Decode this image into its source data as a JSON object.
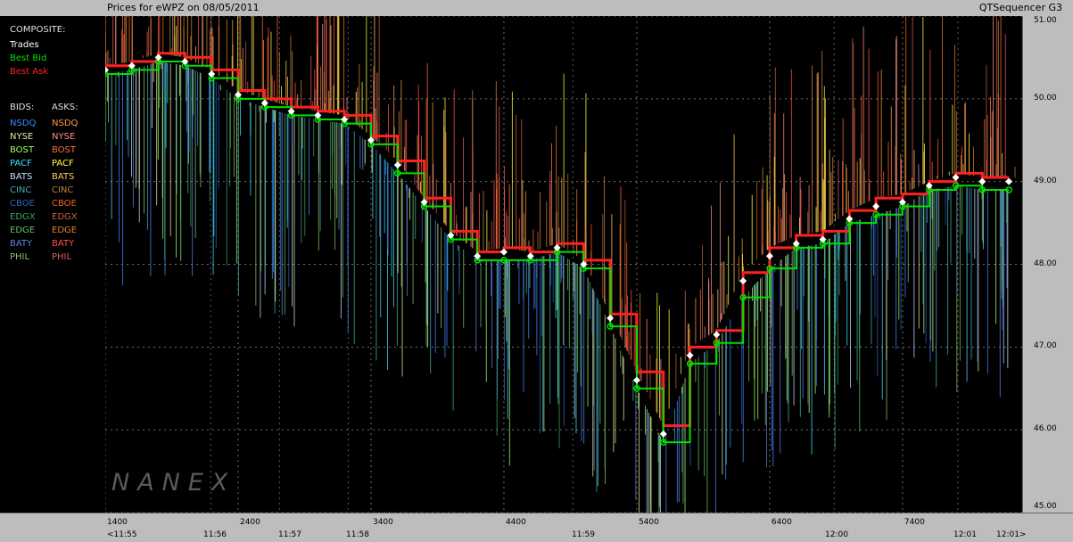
{
  "header": {
    "left_title": "Prices for  eWPZ  on  08/05/2011",
    "right_title": "QTSequencer G3"
  },
  "legend": {
    "composite_label": "COMPOSITE:",
    "trades_label": "Trades",
    "best_bid_label": "Best Bid",
    "best_ask_label": "Best Ask",
    "bids_header": "BIDS:",
    "asks_header": "ASKS:",
    "exchanges": [
      {
        "bid": "NSDQ",
        "ask": "NSDQ",
        "bid_color": "#3c8cff",
        "ask_color": "#ff9a40"
      },
      {
        "bid": "NYSE",
        "ask": "NYSE",
        "bid_color": "#e8e8a0",
        "ask_color": "#ff8c8c"
      },
      {
        "bid": "BOST",
        "ask": "BOST",
        "bid_color": "#a0ff60",
        "ask_color": "#ff7040"
      },
      {
        "bid": "PACF",
        "ask": "PACF",
        "bid_color": "#40e0ff",
        "ask_color": "#ffff40"
      },
      {
        "bid": "BATS",
        "ask": "BATS",
        "bid_color": "#c0e0ff",
        "ask_color": "#ffcc60"
      },
      {
        "bid": "CINC",
        "ask": "CINC",
        "bid_color": "#40b0b0",
        "ask_color": "#c08040"
      },
      {
        "bid": "CBOE",
        "ask": "CBOE",
        "bid_color": "#3060c0",
        "ask_color": "#ff6020"
      },
      {
        "bid": "EDGX",
        "ask": "EDGX",
        "bid_color": "#40a060",
        "ask_color": "#c06040"
      },
      {
        "bid": "EDGE",
        "ask": "EDGE",
        "bid_color": "#60c060",
        "ask_color": "#e08030"
      },
      {
        "bid": "BATY",
        "ask": "BATY",
        "bid_color": "#6080e0",
        "ask_color": "#ff5050"
      },
      {
        "bid": "PHIL",
        "ask": "PHIL",
        "bid_color": "#90c060",
        "ask_color": "#e06060"
      }
    ]
  },
  "watermark": "NANEX",
  "colors": {
    "trades": "#ffffff",
    "best_bid": "#00e000",
    "best_ask": "#ff2020",
    "background": "#000000",
    "panel": "#bdbdbd"
  },
  "chart_data": {
    "type": "line",
    "title": "Prices for  eWPZ  on  08/05/2011",
    "ylim": [
      45.0,
      51.0
    ],
    "y_ticks": [
      "45.00",
      "46.00",
      "47.00",
      "48.00",
      "49.00",
      "50.00",
      "51.00"
    ],
    "grid": true,
    "sequence_ticks": [
      "1400",
      "2400",
      "3400",
      "4400",
      "5400",
      "6400",
      "7400"
    ],
    "time_ticks": [
      "<11:55",
      "11:56",
      "11:57",
      "11:58",
      "11:59",
      "12:00",
      "12:01",
      "12:01>"
    ],
    "xlim": [
      1400,
      8300
    ],
    "x": [
      1400,
      1600,
      1800,
      2000,
      2200,
      2400,
      2600,
      2800,
      3000,
      3200,
      3400,
      3600,
      3800,
      4000,
      4200,
      4400,
      4600,
      4800,
      5000,
      5200,
      5400,
      5600,
      5800,
      6000,
      6200,
      6400,
      6600,
      6800,
      7000,
      7200,
      7400,
      7600,
      7800,
      8000,
      8200
    ],
    "series": [
      {
        "name": "Trades",
        "values": [
          50.35,
          50.4,
          50.5,
          50.45,
          50.3,
          50.05,
          49.95,
          49.85,
          49.8,
          49.75,
          49.5,
          49.2,
          48.75,
          48.35,
          48.1,
          48.15,
          48.1,
          48.2,
          48.0,
          47.35,
          46.6,
          45.95,
          46.9,
          47.15,
          47.8,
          48.1,
          48.25,
          48.3,
          48.55,
          48.7,
          48.75,
          48.95,
          49.05,
          49.0,
          49.0
        ]
      },
      {
        "name": "Best Bid",
        "values": [
          50.3,
          50.35,
          50.45,
          50.4,
          50.25,
          50.0,
          49.9,
          49.8,
          49.75,
          49.7,
          49.45,
          49.1,
          48.7,
          48.3,
          48.05,
          48.05,
          48.05,
          48.15,
          47.95,
          47.25,
          46.5,
          45.85,
          46.8,
          47.05,
          47.6,
          47.95,
          48.2,
          48.25,
          48.5,
          48.6,
          48.7,
          48.9,
          48.95,
          48.9,
          48.9
        ]
      },
      {
        "name": "Best Ask",
        "values": [
          50.4,
          50.45,
          50.55,
          50.5,
          50.35,
          50.1,
          50.0,
          49.9,
          49.85,
          49.8,
          49.55,
          49.25,
          48.8,
          48.4,
          48.15,
          48.2,
          48.15,
          48.25,
          48.05,
          47.4,
          46.7,
          46.05,
          47.0,
          47.2,
          47.9,
          48.2,
          48.35,
          48.4,
          48.65,
          48.8,
          48.85,
          49.0,
          49.1,
          49.05,
          49.05
        ]
      }
    ]
  }
}
